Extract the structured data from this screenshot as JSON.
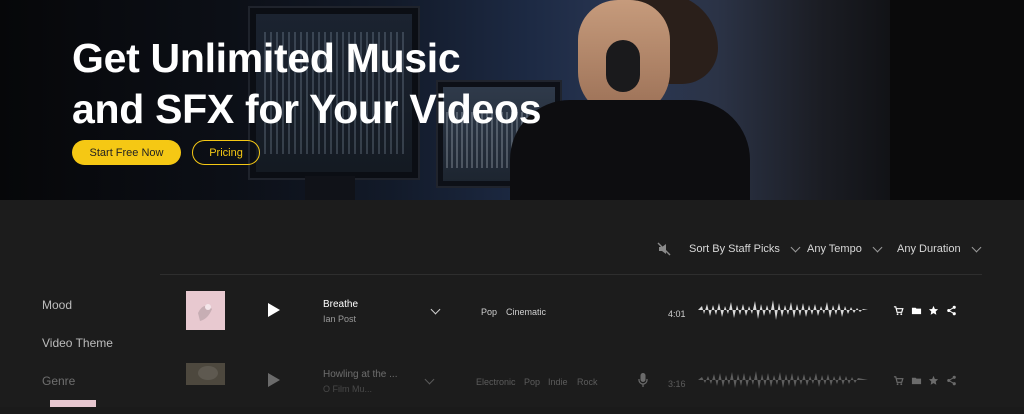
{
  "hero": {
    "title_line1": "Get Unlimited Music",
    "title_line2": "and SFX for Your Videos",
    "cta_primary": "Start Free Now",
    "cta_secondary": "Pricing",
    "accent_color": "#f5c814"
  },
  "filters": {
    "mute_icon": "speaker-off-icon",
    "sort_label": "Sort By Staff Picks",
    "tempo_label": "Any Tempo",
    "duration_label": "Any Duration"
  },
  "sidebar": {
    "items": [
      {
        "label": "Mood"
      },
      {
        "label": "Video Theme"
      },
      {
        "label": "Genre"
      }
    ]
  },
  "tracks": [
    {
      "title": "Breathe",
      "artist": "Ian Post",
      "tags": [
        "Pop",
        "Cinematic"
      ],
      "duration": "4:01"
    },
    {
      "title": "Howling at the ...",
      "artist": "O Film Mu...",
      "tags": [
        "Electronic",
        "Pop",
        "Indie",
        "Rock"
      ],
      "duration": "3:16"
    }
  ]
}
